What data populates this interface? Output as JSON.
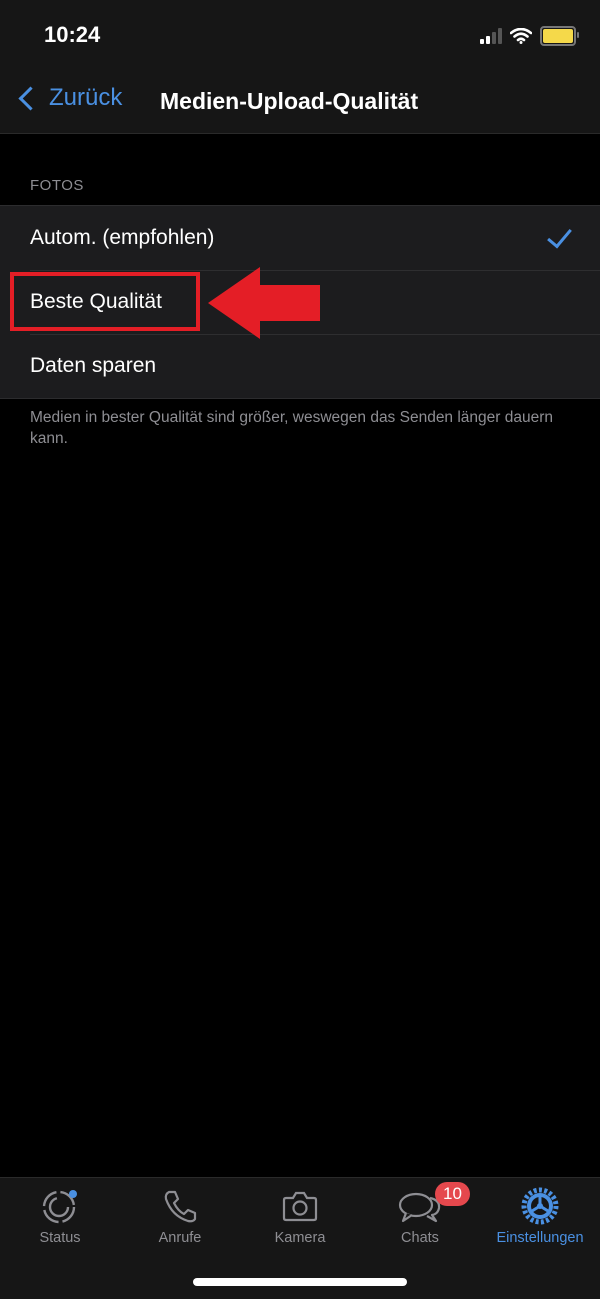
{
  "status_bar": {
    "time": "10:24",
    "signal_bars_active": 2,
    "signal_bars_total": 4,
    "battery_color": "#f5d94a"
  },
  "nav": {
    "back_label": "Zurück",
    "title": "Medien-Upload-Qualität",
    "accent_color": "#4a90e2"
  },
  "section": {
    "header": "FOTOS",
    "options": [
      {
        "label": "Autom. (empfohlen)",
        "selected": true
      },
      {
        "label": "Beste Qualität",
        "selected": false,
        "highlighted": true
      },
      {
        "label": "Daten sparen",
        "selected": false
      }
    ],
    "footer": "Medien in bester Qualität sind größer, weswegen das Senden länger dauern kann."
  },
  "annotation": {
    "color": "#e41e26",
    "target": "Beste Qualität"
  },
  "tabbar": {
    "tabs": [
      {
        "label": "Status",
        "icon": "status-icon",
        "active": false
      },
      {
        "label": "Anrufe",
        "icon": "phone-icon",
        "active": false
      },
      {
        "label": "Kamera",
        "icon": "camera-icon",
        "active": false
      },
      {
        "label": "Chats",
        "icon": "chats-icon",
        "active": false,
        "badge": "10"
      },
      {
        "label": "Einstellungen",
        "icon": "settings-gear-icon",
        "active": true
      }
    ]
  }
}
